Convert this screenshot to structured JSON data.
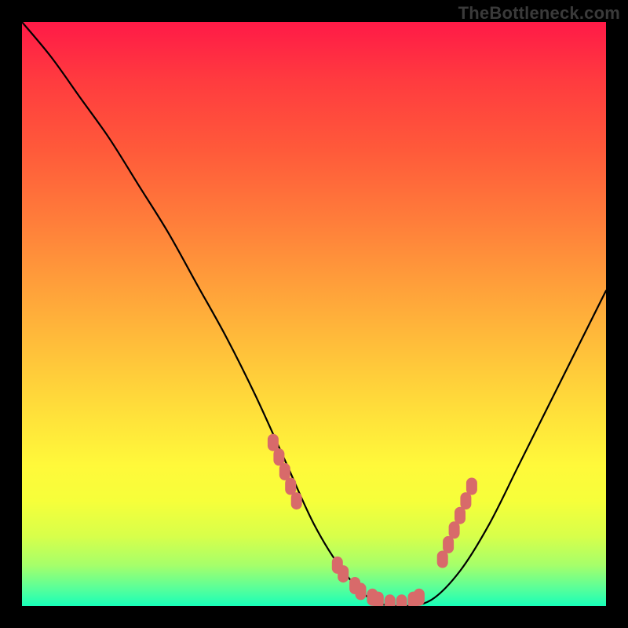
{
  "watermark": "TheBottleneck.com",
  "chart_data": {
    "type": "line",
    "title": "",
    "xlabel": "",
    "ylabel": "",
    "xlim": [
      0,
      100
    ],
    "ylim": [
      0,
      100
    ],
    "x": [
      0,
      5,
      10,
      15,
      20,
      25,
      30,
      35,
      40,
      45,
      50,
      55,
      60,
      65,
      70,
      75,
      80,
      85,
      90,
      95,
      100
    ],
    "values": [
      100,
      94,
      87,
      80,
      72,
      64,
      55,
      46,
      36,
      25,
      14,
      6,
      1,
      0,
      1,
      6,
      14,
      24,
      34,
      44,
      54
    ],
    "scatter_points": {
      "x": [
        43,
        44,
        45,
        46,
        47,
        54,
        55,
        57,
        58,
        60,
        61,
        63,
        65,
        67,
        68,
        72,
        73,
        74,
        75,
        76,
        77
      ],
      "y": [
        28,
        25.5,
        23,
        20.5,
        18,
        7,
        5.5,
        3.5,
        2.5,
        1.5,
        1,
        0.5,
        0.5,
        1,
        1.5,
        8,
        10.5,
        13,
        15.5,
        18,
        20.5
      ]
    },
    "gradient_stops": [
      {
        "pos": 0,
        "color": "#ff1a47"
      },
      {
        "pos": 50,
        "color": "#ffcc33"
      },
      {
        "pos": 90,
        "color": "#ccff55"
      },
      {
        "pos": 100,
        "color": "#18ffb8"
      }
    ]
  }
}
